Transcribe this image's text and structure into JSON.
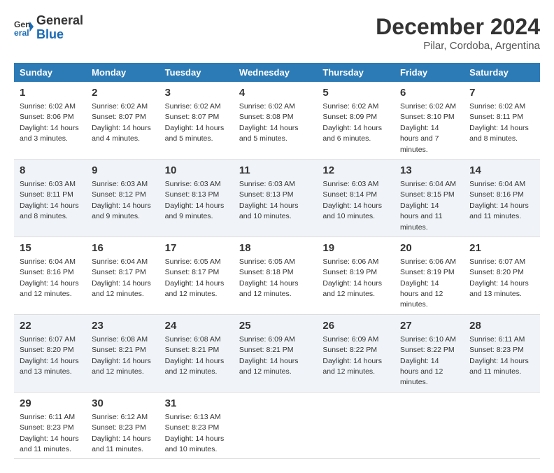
{
  "logo": {
    "line1": "General",
    "line2": "Blue"
  },
  "title": "December 2024",
  "subtitle": "Pilar, Cordoba, Argentina",
  "days_of_week": [
    "Sunday",
    "Monday",
    "Tuesday",
    "Wednesday",
    "Thursday",
    "Friday",
    "Saturday"
  ],
  "weeks": [
    [
      {
        "day": "1",
        "sunrise": "6:02 AM",
        "sunset": "8:06 PM",
        "daylight": "14 hours and 3 minutes."
      },
      {
        "day": "2",
        "sunrise": "6:02 AM",
        "sunset": "8:07 PM",
        "daylight": "14 hours and 4 minutes."
      },
      {
        "day": "3",
        "sunrise": "6:02 AM",
        "sunset": "8:07 PM",
        "daylight": "14 hours and 5 minutes."
      },
      {
        "day": "4",
        "sunrise": "6:02 AM",
        "sunset": "8:08 PM",
        "daylight": "14 hours and 5 minutes."
      },
      {
        "day": "5",
        "sunrise": "6:02 AM",
        "sunset": "8:09 PM",
        "daylight": "14 hours and 6 minutes."
      },
      {
        "day": "6",
        "sunrise": "6:02 AM",
        "sunset": "8:10 PM",
        "daylight": "14 hours and 7 minutes."
      },
      {
        "day": "7",
        "sunrise": "6:02 AM",
        "sunset": "8:11 PM",
        "daylight": "14 hours and 8 minutes."
      }
    ],
    [
      {
        "day": "8",
        "sunrise": "6:03 AM",
        "sunset": "8:11 PM",
        "daylight": "14 hours and 8 minutes."
      },
      {
        "day": "9",
        "sunrise": "6:03 AM",
        "sunset": "8:12 PM",
        "daylight": "14 hours and 9 minutes."
      },
      {
        "day": "10",
        "sunrise": "6:03 AM",
        "sunset": "8:13 PM",
        "daylight": "14 hours and 9 minutes."
      },
      {
        "day": "11",
        "sunrise": "6:03 AM",
        "sunset": "8:13 PM",
        "daylight": "14 hours and 10 minutes."
      },
      {
        "day": "12",
        "sunrise": "6:03 AM",
        "sunset": "8:14 PM",
        "daylight": "14 hours and 10 minutes."
      },
      {
        "day": "13",
        "sunrise": "6:04 AM",
        "sunset": "8:15 PM",
        "daylight": "14 hours and 11 minutes."
      },
      {
        "day": "14",
        "sunrise": "6:04 AM",
        "sunset": "8:16 PM",
        "daylight": "14 hours and 11 minutes."
      }
    ],
    [
      {
        "day": "15",
        "sunrise": "6:04 AM",
        "sunset": "8:16 PM",
        "daylight": "14 hours and 12 minutes."
      },
      {
        "day": "16",
        "sunrise": "6:04 AM",
        "sunset": "8:17 PM",
        "daylight": "14 hours and 12 minutes."
      },
      {
        "day": "17",
        "sunrise": "6:05 AM",
        "sunset": "8:17 PM",
        "daylight": "14 hours and 12 minutes."
      },
      {
        "day": "18",
        "sunrise": "6:05 AM",
        "sunset": "8:18 PM",
        "daylight": "14 hours and 12 minutes."
      },
      {
        "day": "19",
        "sunrise": "6:06 AM",
        "sunset": "8:19 PM",
        "daylight": "14 hours and 12 minutes."
      },
      {
        "day": "20",
        "sunrise": "6:06 AM",
        "sunset": "8:19 PM",
        "daylight": "14 hours and 12 minutes."
      },
      {
        "day": "21",
        "sunrise": "6:07 AM",
        "sunset": "8:20 PM",
        "daylight": "14 hours and 13 minutes."
      }
    ],
    [
      {
        "day": "22",
        "sunrise": "6:07 AM",
        "sunset": "8:20 PM",
        "daylight": "14 hours and 13 minutes."
      },
      {
        "day": "23",
        "sunrise": "6:08 AM",
        "sunset": "8:21 PM",
        "daylight": "14 hours and 12 minutes."
      },
      {
        "day": "24",
        "sunrise": "6:08 AM",
        "sunset": "8:21 PM",
        "daylight": "14 hours and 12 minutes."
      },
      {
        "day": "25",
        "sunrise": "6:09 AM",
        "sunset": "8:21 PM",
        "daylight": "14 hours and 12 minutes."
      },
      {
        "day": "26",
        "sunrise": "6:09 AM",
        "sunset": "8:22 PM",
        "daylight": "14 hours and 12 minutes."
      },
      {
        "day": "27",
        "sunrise": "6:10 AM",
        "sunset": "8:22 PM",
        "daylight": "14 hours and 12 minutes."
      },
      {
        "day": "28",
        "sunrise": "6:11 AM",
        "sunset": "8:23 PM",
        "daylight": "14 hours and 11 minutes."
      }
    ],
    [
      {
        "day": "29",
        "sunrise": "6:11 AM",
        "sunset": "8:23 PM",
        "daylight": "14 hours and 11 minutes."
      },
      {
        "day": "30",
        "sunrise": "6:12 AM",
        "sunset": "8:23 PM",
        "daylight": "14 hours and 11 minutes."
      },
      {
        "day": "31",
        "sunrise": "6:13 AM",
        "sunset": "8:23 PM",
        "daylight": "14 hours and 10 minutes."
      },
      null,
      null,
      null,
      null
    ]
  ],
  "labels": {
    "sunrise": "Sunrise:",
    "sunset": "Sunset:",
    "daylight": "Daylight:"
  }
}
